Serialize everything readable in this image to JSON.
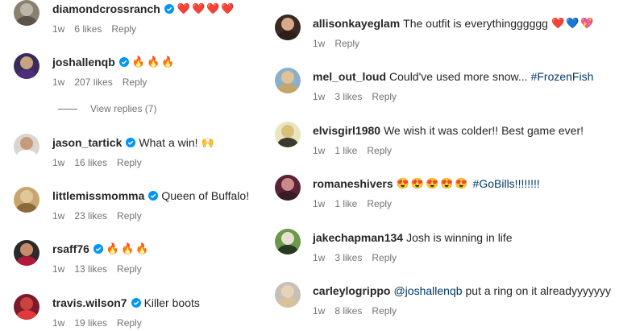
{
  "left_comments": [
    {
      "username": "diamondcrossranch",
      "verified": true,
      "text": "",
      "emoji": "❤️❤️❤️❤️",
      "age": "1w",
      "likes": "6 likes",
      "reply": "Reply",
      "avatar_colors": [
        "#8a8070",
        "#bdb6a8",
        "#5b5348"
      ]
    },
    {
      "username": "joshallenqb",
      "verified": true,
      "text": "",
      "emoji": "🔥🔥🔥",
      "age": "1w",
      "likes": "207 likes",
      "reply": "Reply",
      "avatar_colors": [
        "#3b2a5c",
        "#c9a27e",
        "#4b2f7a"
      ]
    },
    {
      "username": "jason_tartick",
      "verified": true,
      "text": "What a win!",
      "emoji": "🙌",
      "age": "1w",
      "likes": "16 likes",
      "reply": "Reply",
      "avatar_colors": [
        "#d9d6d0",
        "#c79a7b",
        "#ffffff"
      ]
    },
    {
      "username": "littlemissmomma",
      "verified": true,
      "text": "Queen of Buffalo!",
      "emoji": "",
      "age": "1w",
      "likes": "23 likes",
      "reply": "Reply",
      "avatar_colors": [
        "#c9a56f",
        "#e2c79d",
        "#8a6a3a"
      ]
    },
    {
      "username": "rsaff76",
      "verified": true,
      "text": "",
      "emoji": "🔥🔥🔥",
      "age": "1w",
      "likes": "13 likes",
      "reply": "Reply",
      "avatar_colors": [
        "#2a2a2a",
        "#c98c6b",
        "#b0193a"
      ]
    },
    {
      "username": "travis.wilson7",
      "verified": true,
      "text": "Killer boots",
      "emoji": "",
      "age": "1w",
      "likes": "19 likes",
      "reply": "Reply",
      "avatar_colors": [
        "#7a1a2a",
        "#c9443c",
        "#e23a3a"
      ]
    }
  ],
  "view_replies": "View replies (7)",
  "right_comments": [
    {
      "username": "allisonkayeglam",
      "verified": false,
      "text": "The outfit is everythingggggg",
      "hashtag": "",
      "emoji": "❤️💙💖",
      "age": "1w",
      "likes": "",
      "reply": "Reply",
      "avatar_colors": [
        "#3a2a22",
        "#d9a98a",
        "#2c2018"
      ]
    },
    {
      "username": "mel_out_loud",
      "verified": false,
      "text": "Could've used more snow...",
      "hashtag": "#FrozenFish",
      "emoji": "",
      "age": "1w",
      "likes": "3 likes",
      "reply": "Reply",
      "avatar_colors": [
        "#8ab0c8",
        "#e0c29a",
        "#c7a46a"
      ]
    },
    {
      "username": "elvisgirl1980",
      "verified": false,
      "text": "We wish it was colder!! Best game ever!",
      "hashtag": "",
      "emoji": "",
      "age": "1w",
      "likes": "1 like",
      "reply": "Reply",
      "avatar_colors": [
        "#e8e6c0",
        "#d8c07a",
        "#3c3a2a"
      ]
    },
    {
      "username": "romaneshivers",
      "verified": false,
      "text": "",
      "hashtag": "#GoBills!!!!!!!!",
      "emoji": "😍😍😍😍😍",
      "age": "1w",
      "likes": "1 like",
      "reply": "Reply",
      "avatar_colors": [
        "#5a2236",
        "#c98a8a",
        "#3a1a26"
      ]
    },
    {
      "username": "jakechapman134",
      "verified": false,
      "text": "Josh is winning in life",
      "hashtag": "",
      "emoji": "",
      "age": "1w",
      "likes": "3 likes",
      "reply": "Reply",
      "avatar_colors": [
        "#6a9a4a",
        "#e8e0d0",
        "#2a3a22"
      ]
    },
    {
      "username": "carleylogrippo",
      "verified": false,
      "text": "put a ring on it alreadyyyyyyy",
      "mention": "@joshallenqb",
      "emoji": "",
      "age": "1w",
      "likes": "8 likes",
      "reply": "Reply",
      "avatar_colors": [
        "#c8c0b8",
        "#e8d2b8",
        "#d9c29a"
      ]
    }
  ],
  "colors": {
    "verified": "#0095f6",
    "link": "#00376b",
    "meta": "#737373"
  }
}
